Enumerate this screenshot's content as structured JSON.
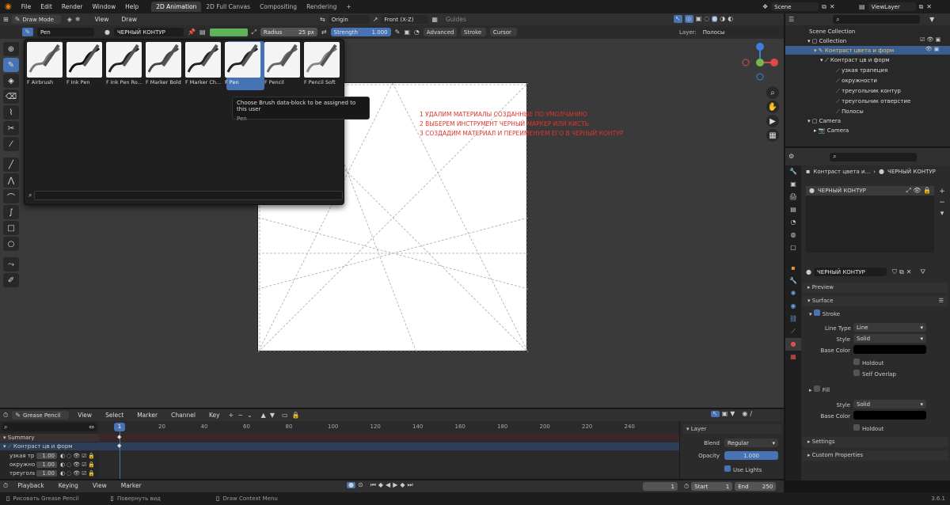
{
  "menus": [
    "File",
    "Edit",
    "Render",
    "Window",
    "Help"
  ],
  "workspaces": [
    {
      "label": "2D Animation",
      "active": true
    },
    {
      "label": "2D Full Canvas",
      "active": false
    },
    {
      "label": "Compositing",
      "active": false
    },
    {
      "label": "Rendering",
      "active": false
    }
  ],
  "add_tab": "+",
  "scene": "Scene",
  "view_layer": "ViewLayer",
  "header": {
    "mode": "Draw Mode",
    "view": "View",
    "draw": "Draw",
    "origin": "Origin",
    "view_axis": "Front (X-Z)",
    "guides": "Guides"
  },
  "toolsettings": {
    "brush_name": "Pen",
    "material": "ЧЕРНЫЙ КОНТУР",
    "radius_label": "Radius",
    "radius_value": "25 px",
    "strength_label": "Strength",
    "strength_value": "1.000",
    "advanced": "Advanced",
    "stroke": "Stroke",
    "cursor": "Cursor",
    "layer_label": "Layer:",
    "layer_value": "Полосы"
  },
  "brushes": [
    {
      "label": "F Airbrush",
      "selected": false
    },
    {
      "label": "F Ink Pen",
      "selected": false
    },
    {
      "label": "F Ink Pen Ro...",
      "selected": false
    },
    {
      "label": "F Marker Bold",
      "selected": false
    },
    {
      "label": "F Marker Ch...",
      "selected": false
    },
    {
      "label": "F Pen",
      "selected": true
    },
    {
      "label": "F Pencil",
      "selected": false
    },
    {
      "label": "F Pencil Soft",
      "selected": false
    }
  ],
  "tooltip": {
    "title": "Choose Brush data-block to be assigned to this user",
    "value": "Pen"
  },
  "annotations": [
    "1 УДАЛИМ МАТЕРИАЛЫ СОЗДАННЫЕ ПО УМОЛЧАНИЮ",
    "2 ВЫБЕРЕМ ИНСТРУМЕНТ ЧЕРНЫЙ МАРКЕР ИЛИ КИСТЬ",
    "3 СОЗДАДИМ МАТЕРИАЛ И ПЕРЕИМЕНУЕМ ЕГО В ЧЕРНЫЙ КОНТУР"
  ],
  "outliner": {
    "root": "Scene Collection",
    "collection": "Collection",
    "gp_object": "Контраст цвета и форм",
    "gp_data": "Контраст цв и форм",
    "layers": [
      "узкая трапеция",
      "окружности",
      "треугольник контур",
      "треугольник отверстие",
      "Полосы"
    ],
    "camera_obj": "Camera",
    "camera_data": "Camera"
  },
  "properties": {
    "breadcrumb_obj": "Контраст цвета и...",
    "breadcrumb_mat": "ЧЕРНЫЙ КОНТУР",
    "slot": "ЧЕРНЫЙ КОНТУР",
    "material_name": "ЧЕРНЫЙ КОНТУР",
    "preview": "Preview",
    "surface": "Surface",
    "stroke": "Stroke",
    "line_type_label": "Line Type",
    "line_type": "Line",
    "style_label": "Style",
    "style": "Solid",
    "base_color_label": "Base Color",
    "holdout": "Holdout",
    "self_overlap": "Self Overlap",
    "fill": "Fill",
    "fill_style": "Solid",
    "settings": "Settings",
    "custom_props": "Custom Properties"
  },
  "timeline_header": {
    "editor": "Grease Pencil",
    "view": "View",
    "select": "Select",
    "marker": "Marker",
    "channel": "Channel",
    "key": "Key"
  },
  "timeline": {
    "current_frame": "1",
    "ticks": [
      "20",
      "40",
      "60",
      "80",
      "100",
      "120",
      "140",
      "160",
      "180",
      "200",
      "220",
      "240"
    ],
    "summary": "Summary",
    "object": "Контраст цв и форм",
    "rows": [
      {
        "name": "узкая тр",
        "opacity": "1.00"
      },
      {
        "name": "окружно",
        "opacity": "1.00"
      },
      {
        "name": "треуголь",
        "opacity": "1.00"
      }
    ]
  },
  "layer_panel": {
    "title": "Layer",
    "blend_label": "Blend",
    "blend": "Regular",
    "opacity_label": "Opacity",
    "opacity": "1.000",
    "use_lights": "Use Lights"
  },
  "playback": {
    "playback": "Playback",
    "keying": "Keying",
    "view": "View",
    "marker": "Marker",
    "frame": "1",
    "start_label": "Start",
    "start": "1",
    "end_label": "End",
    "end": "250"
  },
  "status": {
    "left": "Рисовать Grease Pencil",
    "mid": "Повернуть вид",
    "right": "Draw Context Menu",
    "version": "3.6.1"
  },
  "colors": {
    "accent": "#4772b3",
    "annotation": "#e0342c",
    "viewport": "#3a3a3a",
    "canvas": "#ffffff"
  }
}
